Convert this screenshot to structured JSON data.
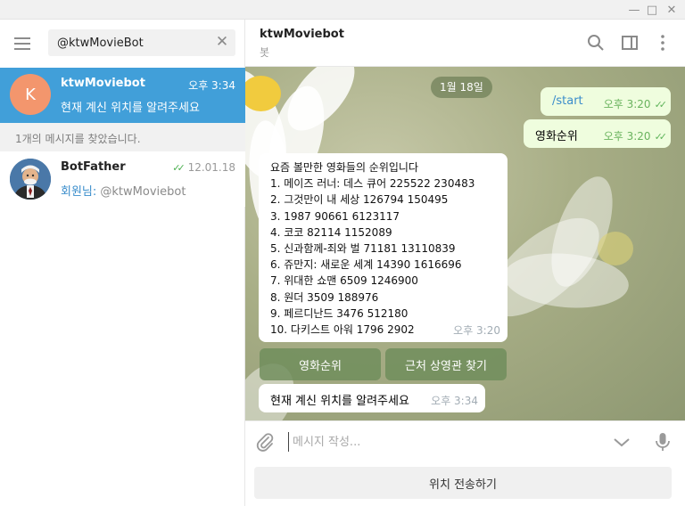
{
  "window": {
    "minimize": "—",
    "maximize": "□",
    "close": "✕"
  },
  "search": {
    "value": "@ktwMovieBot",
    "clear": "✕"
  },
  "chats": [
    {
      "avatar_letter": "K",
      "avatar_color": "#f3966d",
      "name": "ktwMoviebot",
      "time": "오후 3:34",
      "preview": "현재 계신 위치를 알려주세요"
    },
    {
      "name": "BotFather",
      "time": "12.01.18",
      "preview_prefix": "회원님: ",
      "preview": "@ktwMoviebot"
    }
  ],
  "found_text": "1개의 메시지를 찾았습니다.",
  "header": {
    "title": "ktwMoviebot",
    "subtitle": "봇"
  },
  "date_separator": "1월 18일",
  "messages": [
    {
      "text": "/start",
      "time": "오후 3:20"
    },
    {
      "text": "영화순위",
      "time": "오후 3:20"
    },
    {
      "lines": [
        "요즘 볼만한 영화들의 순위입니다",
        "1. 메이즈 러너: 데스 큐어 225522 230483",
        "2. 그것만이 내 세상 126794 150495",
        "3. 1987 90661 6123117",
        "4. 코코 82114 1152089",
        "5. 신과함께-죄와 벌 71181 13110839",
        "6. 쥬만지: 새로운 세계 14390 1616696",
        "7. 위대한 쇼맨 6509 1246900",
        "8. 원더 3509 188976",
        "9. 페르디난드 3476 512180",
        "10. 다키스트 아워 1796 2902"
      ],
      "time": "오후 3:20"
    },
    {
      "text": "현재 계신 위치를 알려주세요",
      "time": "오후 3:34"
    }
  ],
  "keyboard": {
    "button1": "영화순위",
    "button2": "근처 상영관 찾기"
  },
  "composer": {
    "placeholder": "메시지 작성..."
  },
  "bottom_button": "위치 전송하기",
  "colors": {
    "accent": "#419fd9",
    "outgoing_bubble": "#effdde",
    "read_check": "#4cb050"
  }
}
